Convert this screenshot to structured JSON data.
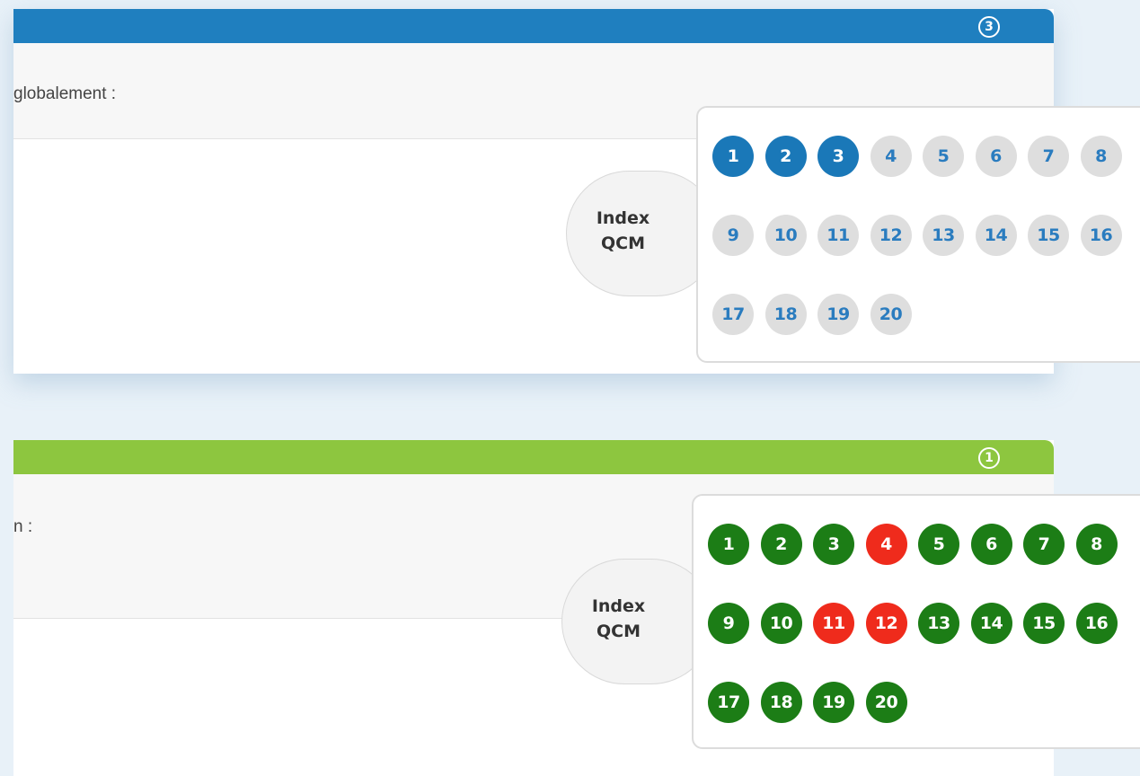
{
  "colors": {
    "header_blue": "#1f7fbf",
    "header_green": "#8dc63f",
    "current": "#1a78b8",
    "pending_bg": "#dedede",
    "pending_text": "#2a7cbf",
    "correct": "#1c7d16",
    "wrong": "#ef2b1c"
  },
  "cards": [
    {
      "badge": "3",
      "question_text": "globalement :",
      "index_label_line1": "Index",
      "index_label_line2": "QCM",
      "questions": [
        {
          "n": "1",
          "status": "current"
        },
        {
          "n": "2",
          "status": "current"
        },
        {
          "n": "3",
          "status": "current"
        },
        {
          "n": "4",
          "status": "pending"
        },
        {
          "n": "5",
          "status": "pending"
        },
        {
          "n": "6",
          "status": "pending"
        },
        {
          "n": "7",
          "status": "pending"
        },
        {
          "n": "8",
          "status": "pending"
        },
        {
          "n": "9",
          "status": "pending"
        },
        {
          "n": "10",
          "status": "pending"
        },
        {
          "n": "11",
          "status": "pending"
        },
        {
          "n": "12",
          "status": "pending"
        },
        {
          "n": "13",
          "status": "pending"
        },
        {
          "n": "14",
          "status": "pending"
        },
        {
          "n": "15",
          "status": "pending"
        },
        {
          "n": "16",
          "status": "pending"
        },
        {
          "n": "17",
          "status": "pending"
        },
        {
          "n": "18",
          "status": "pending"
        },
        {
          "n": "19",
          "status": "pending"
        },
        {
          "n": "20",
          "status": "pending"
        }
      ]
    },
    {
      "badge": "1",
      "question_text": "n :",
      "index_label_line1": "Index",
      "index_label_line2": "QCM",
      "questions": [
        {
          "n": "1",
          "status": "correct"
        },
        {
          "n": "2",
          "status": "correct"
        },
        {
          "n": "3",
          "status": "correct"
        },
        {
          "n": "4",
          "status": "wrong"
        },
        {
          "n": "5",
          "status": "correct"
        },
        {
          "n": "6",
          "status": "correct"
        },
        {
          "n": "7",
          "status": "correct"
        },
        {
          "n": "8",
          "status": "correct"
        },
        {
          "n": "9",
          "status": "correct"
        },
        {
          "n": "10",
          "status": "correct"
        },
        {
          "n": "11",
          "status": "wrong"
        },
        {
          "n": "12",
          "status": "wrong"
        },
        {
          "n": "13",
          "status": "correct"
        },
        {
          "n": "14",
          "status": "correct"
        },
        {
          "n": "15",
          "status": "correct"
        },
        {
          "n": "16",
          "status": "correct"
        },
        {
          "n": "17",
          "status": "correct"
        },
        {
          "n": "18",
          "status": "correct"
        },
        {
          "n": "19",
          "status": "correct"
        },
        {
          "n": "20",
          "status": "correct"
        }
      ]
    }
  ]
}
